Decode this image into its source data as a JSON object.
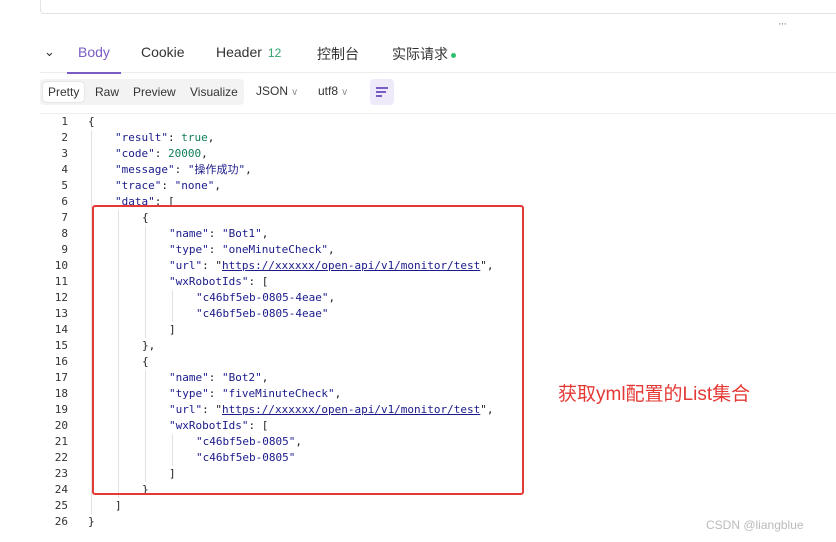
{
  "tabs": {
    "body": "Body",
    "cookie": "Cookie",
    "header": "Header",
    "header_count": "12",
    "console": "控制台",
    "actual_request": "实际请求"
  },
  "toolbar": {
    "pretty": "Pretty",
    "raw": "Raw",
    "preview": "Preview",
    "visualize": "Visualize",
    "format": "JSON",
    "encoding": "utf8"
  },
  "code_lines": [
    {
      "no": "1",
      "indent": 0,
      "parts": [
        {
          "t": "{",
          "c": "p"
        }
      ]
    },
    {
      "no": "2",
      "indent": 1,
      "parts": [
        {
          "t": "\"result\"",
          "c": "k"
        },
        {
          "t": ": ",
          "c": "p"
        },
        {
          "t": "true",
          "c": "v"
        },
        {
          "t": ",",
          "c": "p"
        }
      ]
    },
    {
      "no": "3",
      "indent": 1,
      "parts": [
        {
          "t": "\"code\"",
          "c": "k"
        },
        {
          "t": ": ",
          "c": "p"
        },
        {
          "t": "20000",
          "c": "v"
        },
        {
          "t": ",",
          "c": "p"
        }
      ]
    },
    {
      "no": "4",
      "indent": 1,
      "parts": [
        {
          "t": "\"message\"",
          "c": "k"
        },
        {
          "t": ": ",
          "c": "p"
        },
        {
          "t": "\"操作成功\"",
          "c": "s"
        },
        {
          "t": ",",
          "c": "p"
        }
      ]
    },
    {
      "no": "5",
      "indent": 1,
      "parts": [
        {
          "t": "\"trace\"",
          "c": "k"
        },
        {
          "t": ": ",
          "c": "p"
        },
        {
          "t": "\"none\"",
          "c": "s"
        },
        {
          "t": ",",
          "c": "p"
        }
      ]
    },
    {
      "no": "6",
      "indent": 1,
      "parts": [
        {
          "t": "\"data\"",
          "c": "k"
        },
        {
          "t": ": [",
          "c": "p"
        }
      ]
    },
    {
      "no": "7",
      "indent": 2,
      "parts": [
        {
          "t": "{",
          "c": "p"
        }
      ]
    },
    {
      "no": "8",
      "indent": 3,
      "parts": [
        {
          "t": "\"name\"",
          "c": "k"
        },
        {
          "t": ": ",
          "c": "p"
        },
        {
          "t": "\"Bot1\"",
          "c": "s"
        },
        {
          "t": ",",
          "c": "p"
        }
      ]
    },
    {
      "no": "9",
      "indent": 3,
      "parts": [
        {
          "t": "\"type\"",
          "c": "k"
        },
        {
          "t": ": ",
          "c": "p"
        },
        {
          "t": "\"oneMinuteCheck\"",
          "c": "s"
        },
        {
          "t": ",",
          "c": "p"
        }
      ]
    },
    {
      "no": "10",
      "indent": 3,
      "parts": [
        {
          "t": "\"url\"",
          "c": "k"
        },
        {
          "t": ": \"",
          "c": "p"
        },
        {
          "t": "https://xxxxxx/open-api/v1/monitor/test",
          "c": "u"
        },
        {
          "t": "\",",
          "c": "p"
        }
      ]
    },
    {
      "no": "11",
      "indent": 3,
      "parts": [
        {
          "t": "\"wxRobotIds\"",
          "c": "k"
        },
        {
          "t": ": [",
          "c": "p"
        }
      ]
    },
    {
      "no": "12",
      "indent": 4,
      "parts": [
        {
          "t": "\"c46bf5eb-0805-4eae\"",
          "c": "s"
        },
        {
          "t": ",",
          "c": "p"
        }
      ]
    },
    {
      "no": "13",
      "indent": 4,
      "parts": [
        {
          "t": "\"c46bf5eb-0805-4eae\"",
          "c": "s"
        }
      ]
    },
    {
      "no": "14",
      "indent": 3,
      "parts": [
        {
          "t": "]",
          "c": "p"
        }
      ]
    },
    {
      "no": "15",
      "indent": 2,
      "parts": [
        {
          "t": "},",
          "c": "p"
        }
      ]
    },
    {
      "no": "16",
      "indent": 2,
      "parts": [
        {
          "t": "{",
          "c": "p"
        }
      ]
    },
    {
      "no": "17",
      "indent": 3,
      "parts": [
        {
          "t": "\"name\"",
          "c": "k"
        },
        {
          "t": ": ",
          "c": "p"
        },
        {
          "t": "\"Bot2\"",
          "c": "s"
        },
        {
          "t": ",",
          "c": "p"
        }
      ]
    },
    {
      "no": "18",
      "indent": 3,
      "parts": [
        {
          "t": "\"type\"",
          "c": "k"
        },
        {
          "t": ": ",
          "c": "p"
        },
        {
          "t": "\"fiveMinuteCheck\"",
          "c": "s"
        },
        {
          "t": ",",
          "c": "p"
        }
      ]
    },
    {
      "no": "19",
      "indent": 3,
      "parts": [
        {
          "t": "\"url\"",
          "c": "k"
        },
        {
          "t": ": \"",
          "c": "p"
        },
        {
          "t": "https://xxxxxx/open-api/v1/monitor/test",
          "c": "u"
        },
        {
          "t": "\",",
          "c": "p"
        }
      ]
    },
    {
      "no": "20",
      "indent": 3,
      "parts": [
        {
          "t": "\"wxRobotIds\"",
          "c": "k"
        },
        {
          "t": ": [",
          "c": "p"
        }
      ]
    },
    {
      "no": "21",
      "indent": 4,
      "parts": [
        {
          "t": "\"c46bf5eb-0805\"",
          "c": "s"
        },
        {
          "t": ",",
          "c": "p"
        }
      ]
    },
    {
      "no": "22",
      "indent": 4,
      "parts": [
        {
          "t": "\"c46bf5eb-0805\"",
          "c": "s"
        }
      ]
    },
    {
      "no": "23",
      "indent": 3,
      "parts": [
        {
          "t": "]",
          "c": "p"
        }
      ]
    },
    {
      "no": "24",
      "indent": 2,
      "parts": [
        {
          "t": "}",
          "c": "p"
        }
      ]
    },
    {
      "no": "25",
      "indent": 1,
      "parts": [
        {
          "t": "]",
          "c": "p"
        }
      ]
    },
    {
      "no": "26",
      "indent": 0,
      "parts": [
        {
          "t": "}",
          "c": "p"
        }
      ]
    }
  ],
  "annotation": "获取yml配置的List集合",
  "watermark": "CSDN @liangblue",
  "colors": {
    "accent": "#7b5cc4",
    "annotation_red": "#e53935",
    "badge_green": "#2fa46b"
  },
  "icons": {
    "collapse": "chevron-down-icon",
    "more": "more-dots-icon",
    "wrap": "wrap-lines-icon"
  }
}
